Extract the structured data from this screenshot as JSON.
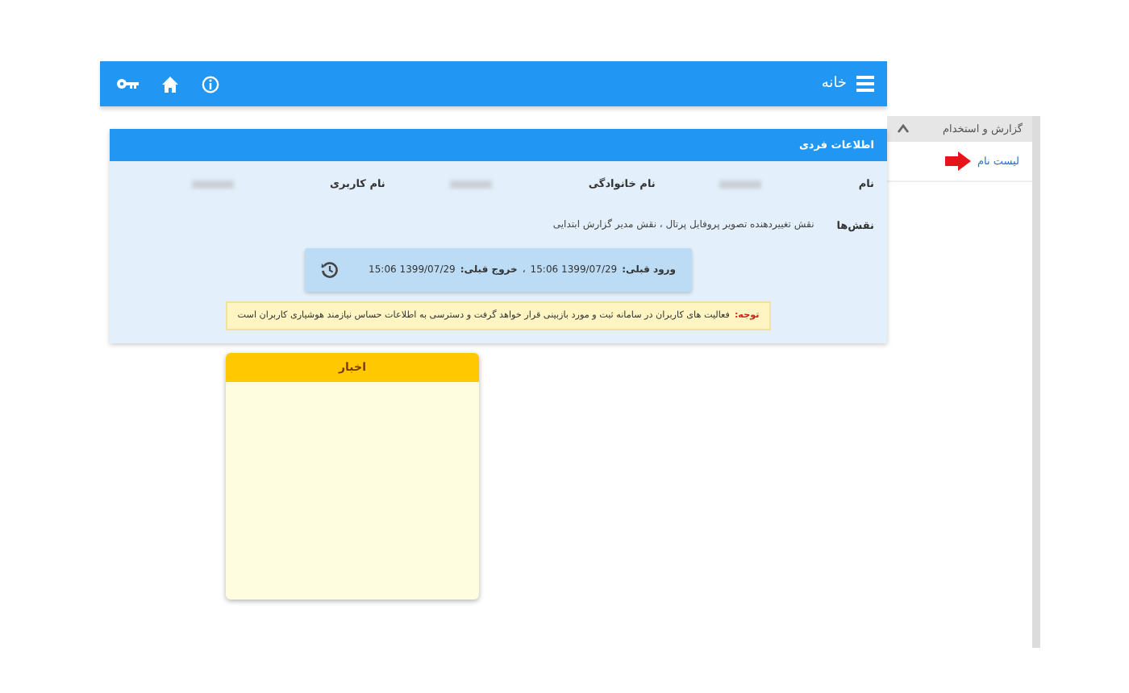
{
  "top_bar": {
    "title": "خانه"
  },
  "profile_panel": {
    "title": "اطلاعات فردی",
    "fields": [
      {
        "label": "نام"
      },
      {
        "label": "نام خانوادگی"
      },
      {
        "label": "نام کاربری"
      }
    ],
    "roles": {
      "label": "نقش‌ها",
      "value": "نقش تغییردهنده تصویر پروفایل پرتال ، نقش مدیر گزارش ابتدایی"
    },
    "last_session": {
      "login_label": "ورود قبلی:",
      "login": "1399/07/29 15:06",
      "separator": "،",
      "logout_label": "خروج قبلی:",
      "logout": "1399/07/29 15:06"
    },
    "notice": {
      "label": "توجه:",
      "text": "فعالیت های کاربران در سامانه ثبت و مورد بازبینی قرار خواهد گرفت و دسترسی به اطلاعات حساس نیازمند هوشیاری کاربران است"
    }
  },
  "news_card": {
    "title": "اخبار"
  },
  "sidebar": {
    "section": {
      "title": "گزارش و استخدام",
      "expanded": true,
      "items": [
        {
          "label": "لیست نام",
          "highlighted": true
        }
      ]
    }
  }
}
